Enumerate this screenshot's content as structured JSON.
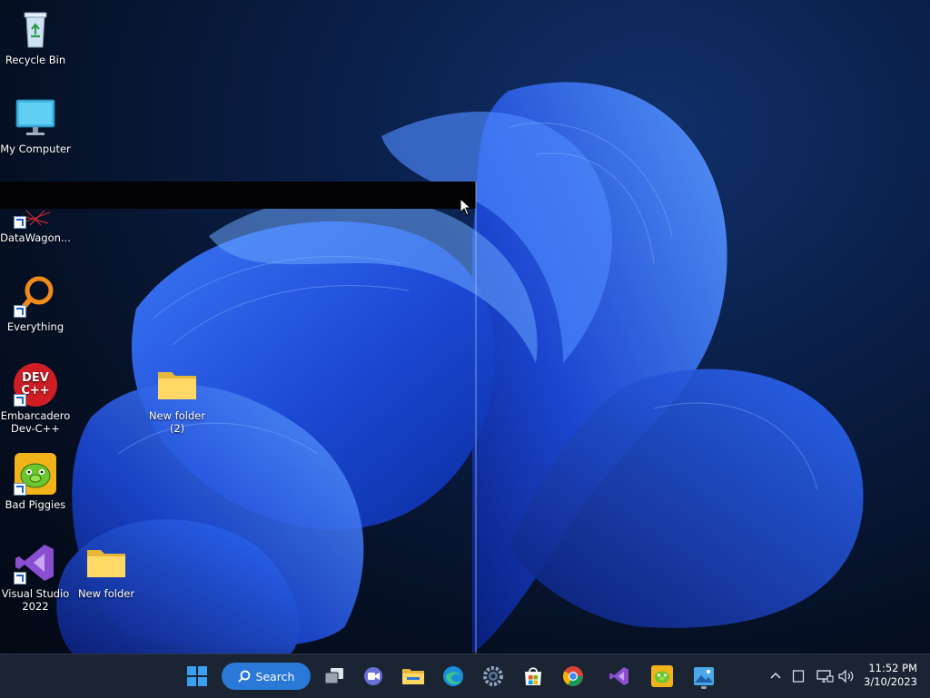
{
  "desktop": {
    "icons": [
      {
        "label": "Recycle Bin",
        "icon": "recycle-bin-icon"
      },
      {
        "label": "My Computer",
        "icon": "monitor-icon"
      },
      {
        "label": "DataWagon...",
        "icon": "datawagon-icon"
      },
      {
        "label": "Everything",
        "icon": "magnifier-icon"
      },
      {
        "label": "Embarcadero Dev-C++",
        "icon": "devcpp-icon"
      },
      {
        "label": "Bad Piggies",
        "icon": "bad-piggies-icon"
      },
      {
        "label": "Visual Studio 2022",
        "icon": "visual-studio-icon"
      },
      {
        "label": "New folder",
        "icon": "folder-icon"
      },
      {
        "label": "New folder (2)",
        "icon": "folder-icon"
      }
    ],
    "devcpp_text": "DEV C++"
  },
  "taskbar": {
    "search_label": "Search",
    "apps": [
      "start",
      "search",
      "task-view",
      "teams-chat",
      "file-explorer",
      "edge",
      "settings",
      "microsoft-store",
      "chrome",
      "visual-studio",
      "bad-piggies",
      "photos"
    ],
    "clock": {
      "time": "11:52 PM",
      "date": "3/10/2023"
    },
    "colors": {
      "bar": "#1b2433",
      "search": "#2a78d8",
      "accent": "#0f78d4"
    }
  }
}
